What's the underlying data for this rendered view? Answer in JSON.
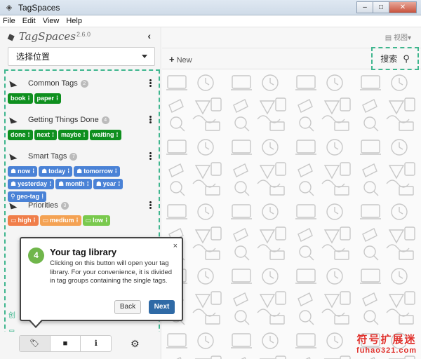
{
  "window": {
    "title": "TagSpaces",
    "minimize": "–",
    "maximize": "□",
    "close": "✕"
  },
  "menu": [
    "File",
    "Edit",
    "View",
    "Help"
  ],
  "sidebar": {
    "logo_text": "TagSpaces",
    "logo_version": "2.6.0",
    "collapse": "‹",
    "location_select": "选择位置",
    "groups": [
      {
        "title": "Common Tags",
        "count": "2",
        "tags": [
          {
            "label": "book"
          },
          {
            "label": "paper"
          }
        ]
      },
      {
        "title": "Getting Things Done",
        "count": "4",
        "tags": [
          {
            "label": "done"
          },
          {
            "label": "next"
          },
          {
            "label": "maybe"
          },
          {
            "label": "waiting"
          }
        ]
      },
      {
        "title": "Smart Tags",
        "count": "7",
        "tags": [
          {
            "label": "now"
          },
          {
            "label": "today"
          },
          {
            "label": "tomorrow"
          },
          {
            "label": "yesterday"
          },
          {
            "label": "month"
          },
          {
            "label": "year"
          },
          {
            "label": "geo-tag"
          }
        ]
      },
      {
        "title": "Priorities",
        "count": "3",
        "tags": [
          {
            "label": "high"
          },
          {
            "label": "medium"
          },
          {
            "label": "low"
          }
        ]
      }
    ],
    "hidden_fragments": {
      "a": "创",
      "b": "导"
    }
  },
  "bottom_tabs": {
    "tags_icon": "🏷",
    "folder_icon": "■",
    "info_icon": "ℹ",
    "settings_icon": "⚙"
  },
  "main": {
    "view_label": "视图",
    "new_label": "New",
    "search_label": "搜索"
  },
  "popover": {
    "step": "4",
    "title": "Your tag library",
    "close": "×",
    "body": "Clicking on this button will open your tag library. For your convenience, it is divided in tag groups containing the single tags.",
    "back": "Back",
    "next": "Next"
  },
  "watermark": {
    "line1": "符号扩展迷",
    "line2": "fuhao321.com"
  },
  "colors": {
    "accent": "#3fb68e",
    "green_tag": "#0e8f1e",
    "blue_tag": "#4a82d6",
    "orange_tag": "#f07e4a",
    "peach_tag": "#f4a253",
    "lime_tag": "#79c94d",
    "next_btn": "#2f6aa6"
  }
}
